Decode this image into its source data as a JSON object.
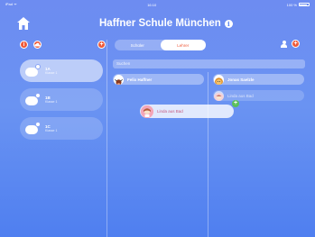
{
  "status": {
    "left": "iPad ᯤ",
    "time": "16:10",
    "right": "100 %"
  },
  "header": {
    "title": "Haffner Schule München",
    "info": "i"
  },
  "left_panel": {
    "add_label": "+",
    "classes": [
      {
        "name": "1A",
        "sub": "Klasse 1"
      },
      {
        "name": "1B",
        "sub": "Klasse 1"
      },
      {
        "name": "1C",
        "sub": "Klasse 1"
      }
    ]
  },
  "segment": {
    "options": [
      "Schüler",
      "Lehrer"
    ],
    "selected": "Lehrer"
  },
  "right_toolbar": {
    "add_label": "+"
  },
  "search": {
    "placeholder": "Suchen"
  },
  "teachers": {
    "items": [
      {
        "name": "Felix Haffner"
      },
      {
        "name": "Jonas Saelzle"
      },
      {
        "name": "Linda aus Bad"
      }
    ],
    "dragging": {
      "name": "Linda aus Bad"
    },
    "drop_badge": "+"
  }
}
